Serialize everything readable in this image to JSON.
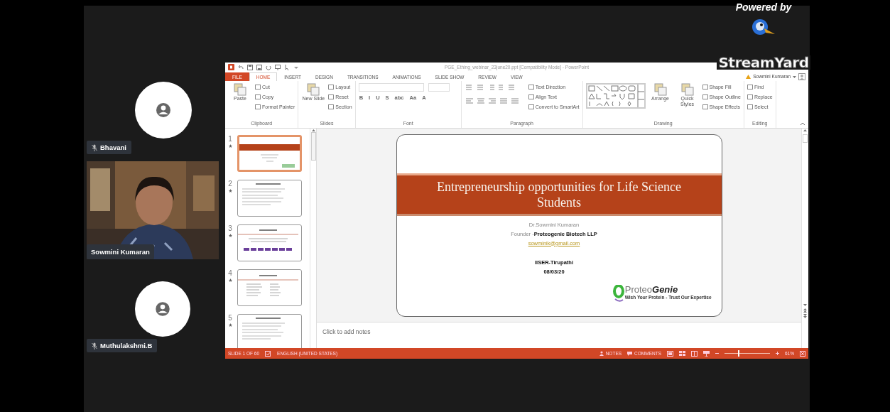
{
  "branding": {
    "caption": "Powered by",
    "logo_text": "StreamYard"
  },
  "participants": [
    {
      "kind": "avatar",
      "name": "Bhavani",
      "muted": true
    },
    {
      "kind": "video",
      "name": "Sowmini Kumaran",
      "muted": false
    },
    {
      "kind": "avatar",
      "name": "Muthulakshmi.B",
      "muted": true
    }
  ],
  "powerpoint": {
    "title": "PGE_Ething_webinar_23june20.ppt [Compatibility Mode] - PowerPoint",
    "tabs": [
      {
        "label": "FILE",
        "kind": "file",
        "selected": false
      },
      {
        "label": "HOME",
        "kind": "tab",
        "selected": true
      },
      {
        "label": "INSERT",
        "kind": "tab",
        "selected": false
      },
      {
        "label": "DESIGN",
        "kind": "tab",
        "selected": false
      },
      {
        "label": "TRANSITIONS",
        "kind": "tab",
        "selected": false
      },
      {
        "label": "ANIMATIONS",
        "kind": "tab",
        "selected": false
      },
      {
        "label": "SLIDE SHOW",
        "kind": "tab",
        "selected": false
      },
      {
        "label": "REVIEW",
        "kind": "tab",
        "selected": false
      },
      {
        "label": "VIEW",
        "kind": "tab",
        "selected": false
      }
    ],
    "account": {
      "name": "Sowmini Kumaran"
    },
    "ribbon": [
      {
        "label": "Clipboard",
        "commands": [
          {
            "kind": "large",
            "label": "Paste"
          },
          {
            "kind": "small",
            "label": "Cut"
          },
          {
            "kind": "small",
            "label": "Copy"
          },
          {
            "kind": "small",
            "label": "Format Painter"
          }
        ]
      },
      {
        "label": "Slides",
        "commands": [
          {
            "kind": "large",
            "label": "New Slide"
          },
          {
            "kind": "small",
            "label": "Layout"
          },
          {
            "kind": "small",
            "label": "Reset"
          },
          {
            "kind": "small",
            "label": "Section"
          }
        ]
      },
      {
        "label": "Font",
        "commands": [
          {
            "kind": "field"
          },
          {
            "kind": "field"
          },
          {
            "kind": "glyph",
            "label": "B"
          },
          {
            "kind": "glyph",
            "label": "I"
          },
          {
            "kind": "glyph",
            "label": "U"
          },
          {
            "kind": "glyph",
            "label": "S"
          },
          {
            "kind": "glyph",
            "label": "abc"
          },
          {
            "kind": "glyph",
            "label": "Aa"
          },
          {
            "kind": "glyph",
            "label": "A"
          }
        ]
      },
      {
        "label": "Paragraph",
        "commands": [
          {
            "kind": "icons"
          },
          {
            "kind": "small",
            "label": "Text Direction"
          },
          {
            "kind": "small",
            "label": "Align Text"
          },
          {
            "kind": "small",
            "label": "Convert to SmartArt"
          }
        ]
      },
      {
        "label": "Drawing",
        "commands": [
          {
            "kind": "gallery"
          },
          {
            "kind": "large",
            "label": "Arrange"
          },
          {
            "kind": "large",
            "label": "Quick Styles"
          },
          {
            "kind": "small",
            "label": "Shape Fill"
          },
          {
            "kind": "small",
            "label": "Shape Outline"
          },
          {
            "kind": "small",
            "label": "Shape Effects"
          }
        ]
      },
      {
        "label": "Editing",
        "commands": [
          {
            "kind": "small",
            "label": "Find"
          },
          {
            "kind": "small",
            "label": "Replace"
          },
          {
            "kind": "small",
            "label": "Select"
          }
        ]
      }
    ],
    "thumbnails": [
      {
        "number": "1",
        "kind": "title",
        "selected": true
      },
      {
        "number": "2",
        "kind": "bullets",
        "selected": false
      },
      {
        "number": "3",
        "kind": "grid",
        "selected": false
      },
      {
        "number": "4",
        "kind": "table",
        "selected": false
      },
      {
        "number": "5",
        "kind": "bullets",
        "selected": false
      }
    ],
    "slide": {
      "title": "Entrepreneurship opportunities for Life Science Students",
      "author": "Dr.Sowmini Kumaran",
      "role": "Founder -**Proteogenie Biotech LLP**",
      "email": "sowminik@gmail.com",
      "venue": "IISER-Tirupathi",
      "date": "08/03/20",
      "logo_name": "Proteo**Genie**",
      "logo_tagline": "Wish Your Protein - Trust Our Expertise"
    },
    "notes_placeholder": "Click to add notes",
    "status_bar": {
      "slide_position": "SLIDE 1 OF 60",
      "language": "ENGLISH (UNITED STATES)",
      "notes": "NOTES",
      "comments": "COMMENTS",
      "zoom": "61%",
      "zoom_slider": {
        "level": 0.32
      }
    }
  }
}
